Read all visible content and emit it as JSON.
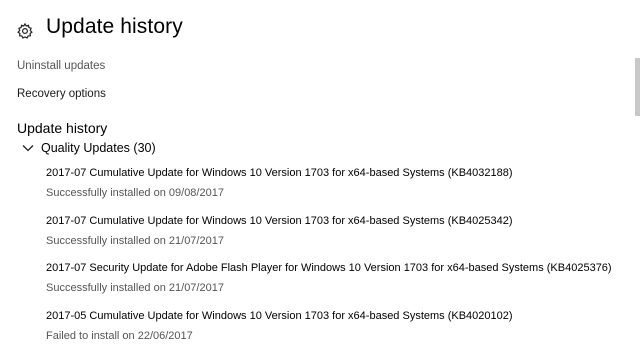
{
  "header": {
    "icon": "gear-icon",
    "title": "Update history"
  },
  "links": {
    "uninstall": "Uninstall updates",
    "recovery": "Recovery options"
  },
  "section": {
    "title": "Update history"
  },
  "group": {
    "icon": "chevron-down-icon",
    "label": "Quality Updates (30)"
  },
  "updates": [
    {
      "title": "2017-07 Cumulative Update for Windows 10 Version 1703 for x64-based Systems (KB4032188)",
      "status": "Successfully installed on 09/08/2017"
    },
    {
      "title": "2017-07 Cumulative Update for Windows 10 Version 1703 for x64-based Systems (KB4025342)",
      "status": "Successfully installed on 21/07/2017"
    },
    {
      "title": "2017-07 Security Update for Adobe Flash Player for Windows 10 Version 1703 for x64-based Systems (KB4025376)",
      "status": "Successfully installed on 21/07/2017"
    },
    {
      "title": "2017-05 Cumulative Update for Windows 10 Version 1703 for x64-based Systems (KB4020102)",
      "status": "Failed to install on 22/06/2017"
    }
  ]
}
